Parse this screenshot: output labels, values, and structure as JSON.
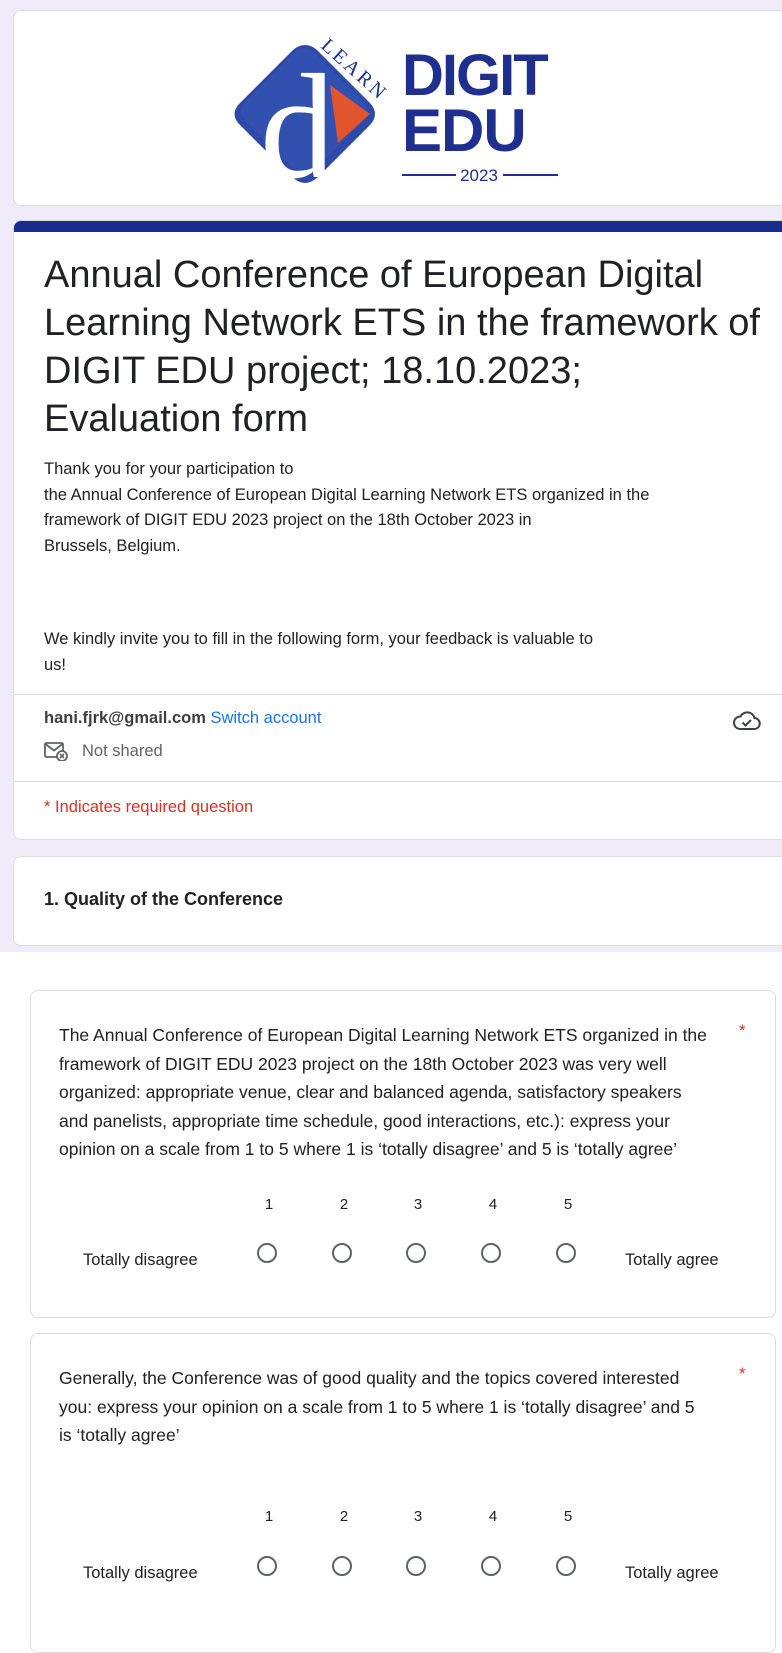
{
  "logo": {
    "arc_text": "LEARN",
    "letter": "d",
    "line1": "DIGIT",
    "line2": "EDU",
    "year": "2023",
    "colors": {
      "navy": "#1f2f8f",
      "orange": "#e0542e",
      "blue_diamond": "#2d4aa8"
    }
  },
  "form": {
    "title": "Annual Conference of European Digital Learning Network ETS in the framework of DIGIT EDU project; 18.10.2023; Evaluation form",
    "description": "Thank you for your participation to\nthe Annual Conference of European Digital Learning Network ETS organized in the framework of DIGIT EDU 2023 project on the 18th October 2023 in\nBrussels, Belgium.",
    "invite": "We kindly invite you to fill in the following form, your feedback is valuable to us!",
    "account_email": "hani.fjrk@gmail.com",
    "switch_account": "Switch account",
    "not_shared": "Not shared",
    "required_note": "* Indicates required question",
    "accent_color": "#1a2d8c"
  },
  "section": {
    "title": "1. Quality of the Conference"
  },
  "questions": [
    {
      "text": "The Annual Conference of European Digital Learning Network ETS organized in the framework of DIGIT EDU 2023 project on the 18th October 2023 was very well organized: appropriate venue, clear and balanced agenda, satisfactory speakers and panelists, appropriate time schedule, good interactions, etc.): express your opinion on a scale from 1 to 5 where 1 is ‘totally disagree’ and 5 is ‘totally agree’",
      "required_mark": "*",
      "low_label": "Totally disagree",
      "high_label": "Totally agree",
      "scale": [
        "1",
        "2",
        "3",
        "4",
        "5"
      ]
    },
    {
      "text": "Generally, the Conference was of good quality and the topics covered interested you:  express your opinion on a scale from 1 to 5 where 1 is ‘totally disagree’ and 5 is ‘totally agree’",
      "required_mark": "*",
      "low_label": "Totally disagree",
      "high_label": "Totally agree",
      "scale": [
        "1",
        "2",
        "3",
        "4",
        "5"
      ]
    }
  ]
}
